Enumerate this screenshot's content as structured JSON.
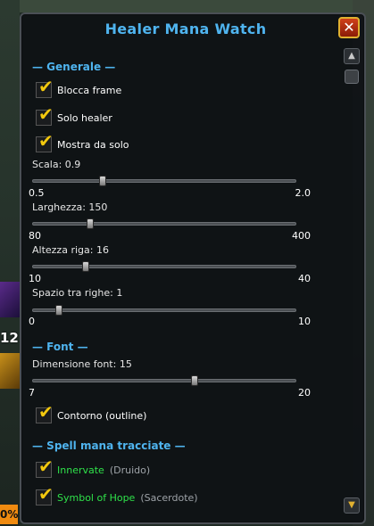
{
  "window": {
    "title": "Healer Mana Watch",
    "close_glyph": "✕"
  },
  "background": {
    "left_badge_number": "12",
    "left_badge_percent": "0%"
  },
  "sections": {
    "generale": "— Generale —",
    "font": "— Font —",
    "spell": "— Spell mana tracciate —"
  },
  "checkboxes": {
    "blocca_frame": {
      "label": "Blocca frame",
      "checked": true
    },
    "solo_healer": {
      "label": "Solo healer",
      "checked": true
    },
    "mostra_da_solo": {
      "label": "Mostra da solo",
      "checked": true
    },
    "contorno": {
      "label": "Contorno (outline)",
      "checked": true
    },
    "innervate": {
      "label": "Innervate",
      "sub": "(Druido)",
      "checked": true
    },
    "symbol_of_hope": {
      "label": "Symbol of Hope",
      "sub": "(Sacerdote)",
      "checked": true
    }
  },
  "sliders": {
    "scala": {
      "label": "Scala: 0.9",
      "min": "0.5",
      "max": "2.0",
      "value": 0.9,
      "range": [
        0.5,
        2.0
      ]
    },
    "larghezza": {
      "label": "Larghezza: 150",
      "min": "80",
      "max": "400",
      "value": 150,
      "range": [
        80,
        400
      ]
    },
    "altezza": {
      "label": "Altezza riga: 16",
      "min": "10",
      "max": "40",
      "value": 16,
      "range": [
        10,
        40
      ]
    },
    "spazio": {
      "label": "Spazio tra righe: 1",
      "min": "0",
      "max": "10",
      "value": 1,
      "range": [
        0,
        10
      ]
    },
    "dimensione_font": {
      "label": "Dimensione font: 15",
      "min": "7",
      "max": "20",
      "value": 15,
      "range": [
        7,
        20
      ]
    }
  },
  "icons": {
    "tick": "✔",
    "scroll_up": "▲",
    "scroll_down": "▼"
  },
  "colors": {
    "accent": "#4fb4ef",
    "check": "#f2c80f",
    "spell_name": "#2fe24a"
  }
}
